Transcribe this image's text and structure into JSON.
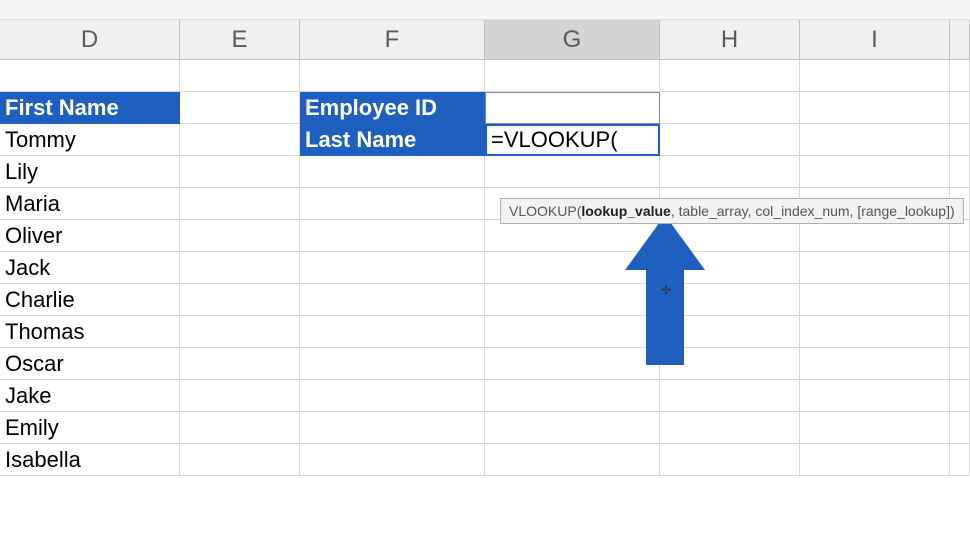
{
  "columns": [
    "D",
    "E",
    "F",
    "G",
    "H",
    "I",
    ""
  ],
  "selected_col_index": 3,
  "headers": {
    "first_name": "First Name",
    "employee_id": "Employee ID",
    "last_name": "Last Name"
  },
  "first_names": [
    "Tommy",
    "Lily",
    "Maria",
    "Oliver",
    "Jack",
    "Charlie",
    "Thomas",
    "Oscar",
    "Jake",
    "Emily",
    "Isabella"
  ],
  "formula": "=VLOOKUP(",
  "tooltip": {
    "prefix": "VLOOKUP(",
    "bold": "lookup_value",
    "suffix": ", table_array, col_index_num, [range_lookup])"
  },
  "colors": {
    "accent": "#1f5fbf"
  }
}
